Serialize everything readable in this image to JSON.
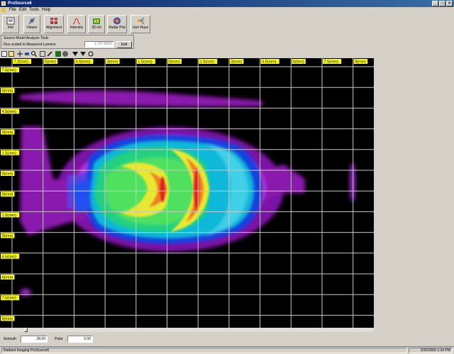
{
  "window": {
    "title": "ProSource6",
    "controls": [
      "minimize",
      "maximize",
      "close"
    ]
  },
  "menu": [
    "File",
    "Edit",
    "Tools",
    "Help"
  ],
  "toolbar": {
    "buttons": [
      {
        "label": "Info",
        "icon": "info-icon"
      },
      {
        "label": "Viewer",
        "icon": "viewer-icon"
      },
      {
        "label": "Alignment",
        "icon": "alignment-icon"
      },
      {
        "label": "Intensity",
        "icon": "intensity-icon"
      },
      {
        "label": "3D-Int",
        "icon": "3d-int-icon"
      },
      {
        "label": "Radar Plot",
        "icon": "radar-plot-icon"
      },
      {
        "label": "Gen Rays",
        "icon": "gen-rays-icon"
      }
    ]
  },
  "analysis_tools": {
    "title": "Source Model Analysis Tools",
    "flux_label": "Flux scaled to Measured Lumens",
    "flux_value": "1.747,8000",
    "edit_label": "Edit"
  },
  "image_toolbar": {
    "icons": [
      "save-icon",
      "open-icon",
      "crosshair-icon",
      "move-icon",
      "zoom-icon",
      "rectangle-icon",
      "pencil-icon",
      "fill-icon",
      "palette-icon",
      "arrow-down-icon",
      "color-icon",
      "circle-icon"
    ]
  },
  "viewer": {
    "x_ticks": [
      "7.2(mm)",
      "5(mm)",
      "4.5(mm)",
      "3(mm)",
      "1.5(mm)",
      "0(mm)",
      "1.5(mm)",
      "3(mm)",
      "4.5(mm)",
      "6(mm)",
      "7.5(mm)",
      "9(mm)"
    ],
    "y_ticks": [
      "7.5(mm)",
      "6(mm)",
      "4.5(mm)",
      "3(mm)",
      "1.5(mm)",
      "0(mm)",
      "0(mm)",
      "1.5(mm)",
      "3(mm)",
      "4.5(mm)",
      "6(mm)",
      "7.5(mm)",
      "9(mm)"
    ],
    "colors": {
      "grid": "#c8c8c8",
      "label_bg": "#ffff00"
    }
  },
  "bottom": {
    "azimuth_label": "Azimuth",
    "azimuth_value": "28.00",
    "polar_label": "Polar",
    "polar_value": "0.00"
  },
  "status": {
    "app": "Radiant Imaging ProSource6",
    "datetime": "3/30/2005  1:34 PM"
  }
}
